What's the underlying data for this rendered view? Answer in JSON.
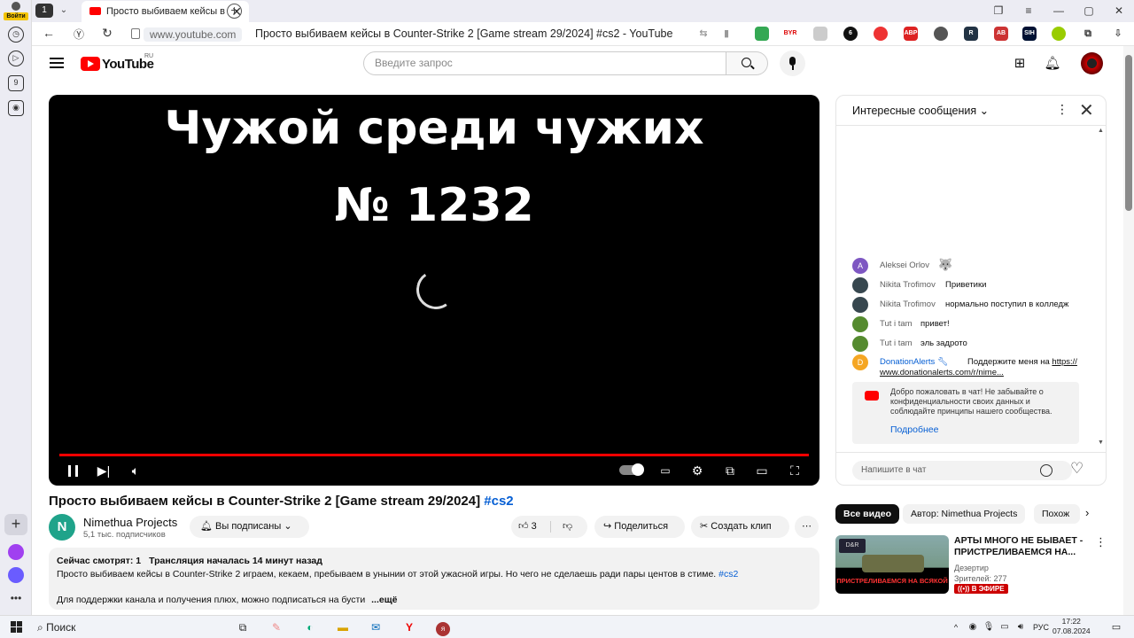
{
  "browser": {
    "login_label": "Войти",
    "tab_count": "1",
    "tab_title": "Просто выбиваем кейсы в",
    "domain": "www.youtube.com",
    "page_title": "Просто выбиваем кейсы в Counter-Strike 2 [Game stream 29/2024] #cs2 - YouTube",
    "rail_badge": "9"
  },
  "youtube": {
    "logo_text": "YouTube",
    "logo_region": "RU",
    "search_placeholder": "Введите запрос"
  },
  "video": {
    "overlay_line1": "Чужой среди чужих",
    "overlay_line2": "№ 1232",
    "progress": 1.0,
    "title": "Просто выбиваем кейсы в Counter-Strike 2 [Game stream 29/2024]",
    "title_tag": "#cs2"
  },
  "channel": {
    "logo_letter": "N",
    "name": "Nimethua Projects",
    "subscribers": "5,1 тыс. подписчиков",
    "subscribed_label": "Вы подписаны"
  },
  "actions": {
    "likes": "3",
    "share": "Поделиться",
    "clip": "Создать клип"
  },
  "description": {
    "watching": "Сейчас смотрят: 1",
    "started": "Трансляция началась 14 минут назад",
    "text": "Просто выбиваем кейсы в Counter-Strike 2 играем, кекаем, пребываем в унынии от этой ужасной игры. Но чего не сделаешь ради пары центов в стиме.",
    "hashtag": "#cs2",
    "support": "Для поддержки канала и получения плюх, можно подписаться на бусти",
    "more": "...ещё"
  },
  "chat": {
    "header": "Интересные сообщения",
    "messages": [
      {
        "author": "Aleksei Orlov",
        "text": "🐺",
        "initial": "A",
        "color": "#7e57c2"
      },
      {
        "author": "Nikita Trofimov",
        "text": "Приветики",
        "initial": "",
        "color": "#37474f"
      },
      {
        "author": "Nikita Trofimov",
        "text": "нормально поступил в колледж",
        "initial": "",
        "color": "#37474f"
      },
      {
        "author": "Tut i tam",
        "text": "привет!",
        "initial": "",
        "color": "#558b2f"
      },
      {
        "author": "Tut i tam",
        "text": "эль задрото",
        "initial": "",
        "color": "#558b2f"
      }
    ],
    "donation_author": "DonationAlerts",
    "donation_text": "Поддержите меня на",
    "donation_link": "https://",
    "donation_link2": "www.donationalerts.com/r/nime...",
    "welcome": "Добро пожаловать в чат! Не забывайте о конфиденциальности своих данных и соблюдайте принципы нашего сообщества.",
    "learn_more": "Подробнее",
    "input_placeholder": "Напишите в чат"
  },
  "recommendations": {
    "chips": [
      "Все видео",
      "Автор: Nimethua Projects",
      "Похож"
    ],
    "item": {
      "thumb_logo": "D&R",
      "thumb_banner": "ПРИСТРЕЛИВАЕМСЯ НА ВСЯКОЙ",
      "title": "АРТЫ МНОГО НЕ БЫВАЕТ - ПРИСТРЕЛИВАЕМСЯ НА...",
      "channel": "Дезертир",
      "viewers": "Зрителей: 277",
      "live": "В ЭФИРЕ"
    }
  },
  "taskbar": {
    "search_label": "Поиск",
    "lang": "РУС",
    "time": "17:22",
    "date": "07.08.2024"
  }
}
